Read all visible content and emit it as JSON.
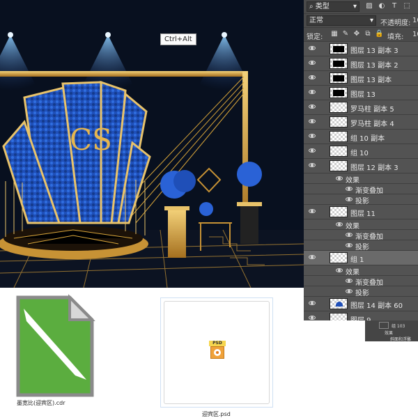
{
  "tooltip": "Ctrl+Alt",
  "panel": {
    "filter_label": "类型",
    "blend_mode": "正常",
    "opacity_label": "不透明度:",
    "opacity_value": "10",
    "lock_label": "锁定:",
    "fill_label": "填充:",
    "fill_value": "10"
  },
  "layers": [
    {
      "name": "图层 13 副本 3",
      "kind": "layer",
      "thumb": "dark"
    },
    {
      "name": "图层 13 副本 2",
      "kind": "layer",
      "thumb": "dark"
    },
    {
      "name": "图层 13 副本",
      "kind": "layer",
      "thumb": "dark"
    },
    {
      "name": "图层 13",
      "kind": "layer",
      "thumb": "dark"
    },
    {
      "name": "罗马柱 副本 5",
      "kind": "layer",
      "thumb": "clear"
    },
    {
      "name": "罗马柱 副本 4",
      "kind": "layer",
      "thumb": "clear"
    },
    {
      "name": "组 10 副本",
      "kind": "layer",
      "thumb": "clear"
    },
    {
      "name": "组 10",
      "kind": "layer",
      "thumb": "clear"
    },
    {
      "name": "图层 12 副本 3",
      "kind": "layer",
      "thumb": "clear"
    },
    {
      "name": "效果",
      "kind": "fx"
    },
    {
      "name": "渐变叠加",
      "kind": "sub"
    },
    {
      "name": "投影",
      "kind": "sub"
    },
    {
      "name": "图层 11",
      "kind": "layer",
      "thumb": "clear"
    },
    {
      "name": "效果",
      "kind": "fx"
    },
    {
      "name": "渐变叠加",
      "kind": "sub"
    },
    {
      "name": "投影",
      "kind": "sub"
    },
    {
      "name": "组 1",
      "kind": "layer",
      "thumb": "clear",
      "active": true
    },
    {
      "name": "效果",
      "kind": "fx"
    },
    {
      "name": "渐变叠加",
      "kind": "sub"
    },
    {
      "name": "投影",
      "kind": "sub"
    },
    {
      "name": "图层 14 副本 60",
      "kind": "layer",
      "thumb": "blue"
    },
    {
      "name": "图层 9",
      "kind": "layer",
      "thumb": "clear"
    }
  ],
  "mini_panel": {
    "name": "组 103",
    "effect": "效果",
    "sub": "斜面和浮雕"
  },
  "files": [
    {
      "caption": "墨宽比(迎宾区).cdr",
      "icon": "coreldraw-file-icon"
    },
    {
      "caption": "迎宾区.psd",
      "icon": "psd-file-icon",
      "badge": "PSD"
    }
  ],
  "artwork": {
    "monogram": "CS",
    "colors": {
      "bg": "#0a1020",
      "gold": "#d9a63a",
      "blue": "#1f4fb8",
      "light": "#8fd0ff"
    }
  }
}
